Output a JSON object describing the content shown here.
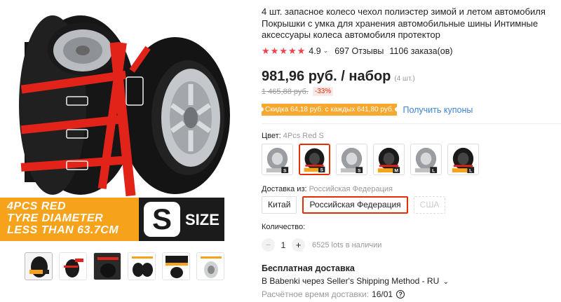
{
  "gallery": {
    "promo_lines": [
      "4PCS RED",
      "TYRE DIAMETER",
      "LESS THAN 63.7CM"
    ],
    "size_letter": "S",
    "size_word": "SIZE",
    "thumbnail_count": 6,
    "accent_color": "#e2231a"
  },
  "product": {
    "title": "4 шт. запасное колесо чехол полиэстер зимой и летом автомобиля Покрышки с умка для хранения автомобильные шины Интимные аксессуары колеса автомобиля протектор",
    "rating": "4.9",
    "reviews": "697 Отзывы",
    "orders": "1106 заказа(ов)",
    "price": "981,96 руб. / набор",
    "per_unit_note": "(4 шт.)",
    "old_price": "1 465,88 руб.",
    "discount": "-33%",
    "coupon_text": "Скидка 64,18 руб. с каждых 641,80 руб.",
    "get_coupons": "Получить купоны"
  },
  "color": {
    "label": "Цвет:",
    "value": "4Pcs Red S",
    "swatches": [
      "gray-s",
      "red-s",
      "gray-m",
      "red-m",
      "gray-l",
      "red-l"
    ],
    "swatch_letters": [
      "S",
      "S",
      "S",
      "M",
      "L",
      "L"
    ],
    "selected_index": 1
  },
  "shipping_from": {
    "label": "Доставка из:",
    "value": "Российская Федерация",
    "options": [
      "Китай",
      "Российская Федерация",
      "США"
    ]
  },
  "quantity": {
    "label": "Количество:",
    "minus": "−",
    "value": "1",
    "plus": "+",
    "stock": "6525 lots в наличии"
  },
  "delivery": {
    "free": "Бесплатная доставка",
    "method": "В Babenki через Seller's Shipping Method - RU",
    "eta_label": "Расчётное время доставки:",
    "eta_date": "16/01",
    "help": "?"
  }
}
